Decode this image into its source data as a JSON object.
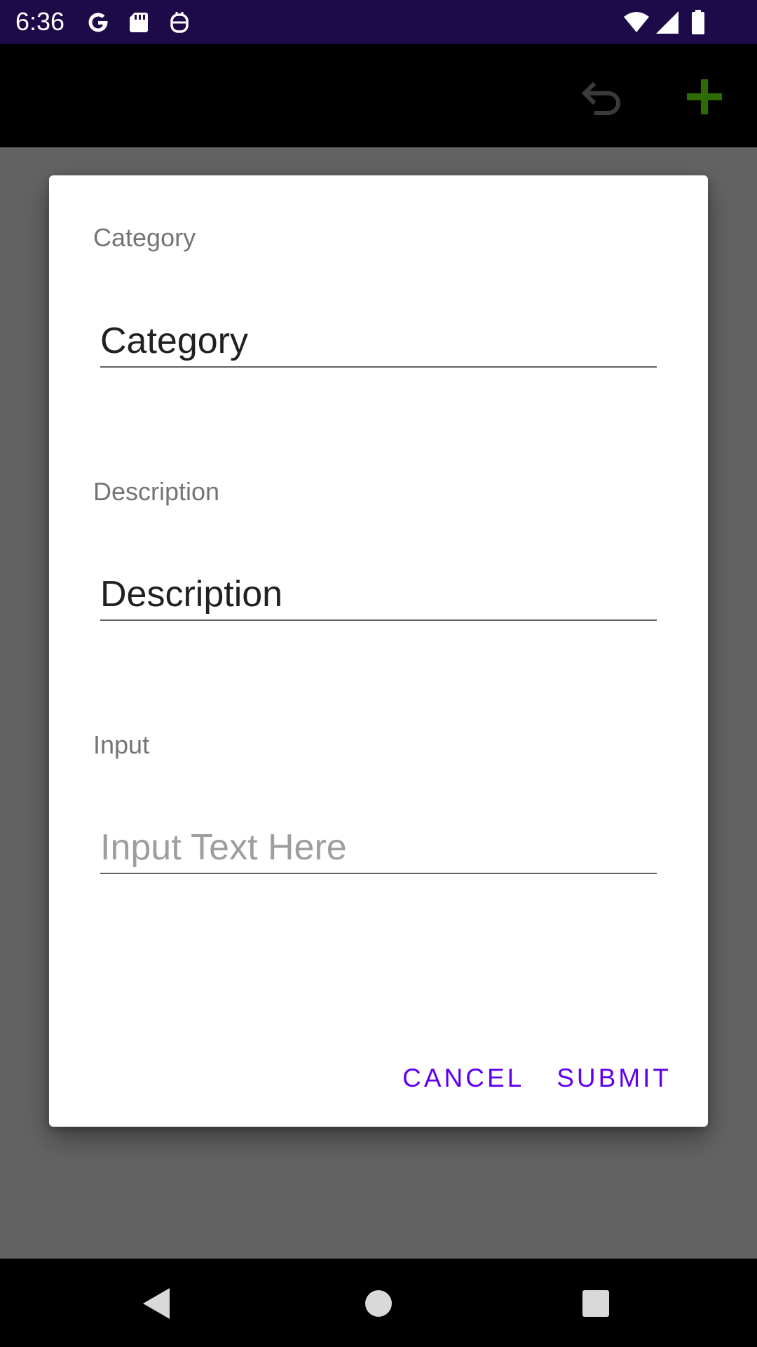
{
  "status_bar": {
    "time": "6:36",
    "left_icons": [
      "google-icon",
      "sd-card-icon",
      "assistant-icon"
    ],
    "right_icons": [
      "wifi-icon",
      "cell-signal-icon",
      "battery-icon"
    ],
    "background": "#1c0a49"
  },
  "app_bar": {
    "actions": [
      "undo-icon",
      "add-icon"
    ],
    "add_icon_color": "#2e6b00"
  },
  "dialog": {
    "fields": [
      {
        "label": "Category",
        "value": "Category",
        "placeholder": ""
      },
      {
        "label": "Description",
        "value": "Description",
        "placeholder": ""
      },
      {
        "label": "Input",
        "value": "",
        "placeholder": "Input Text Here"
      }
    ],
    "actions": {
      "cancel": "CANCEL",
      "submit": "SUBMIT"
    },
    "accent_color": "#6200ee"
  },
  "nav_bar": {
    "buttons": [
      "back-icon",
      "home-icon",
      "recents-icon"
    ]
  }
}
